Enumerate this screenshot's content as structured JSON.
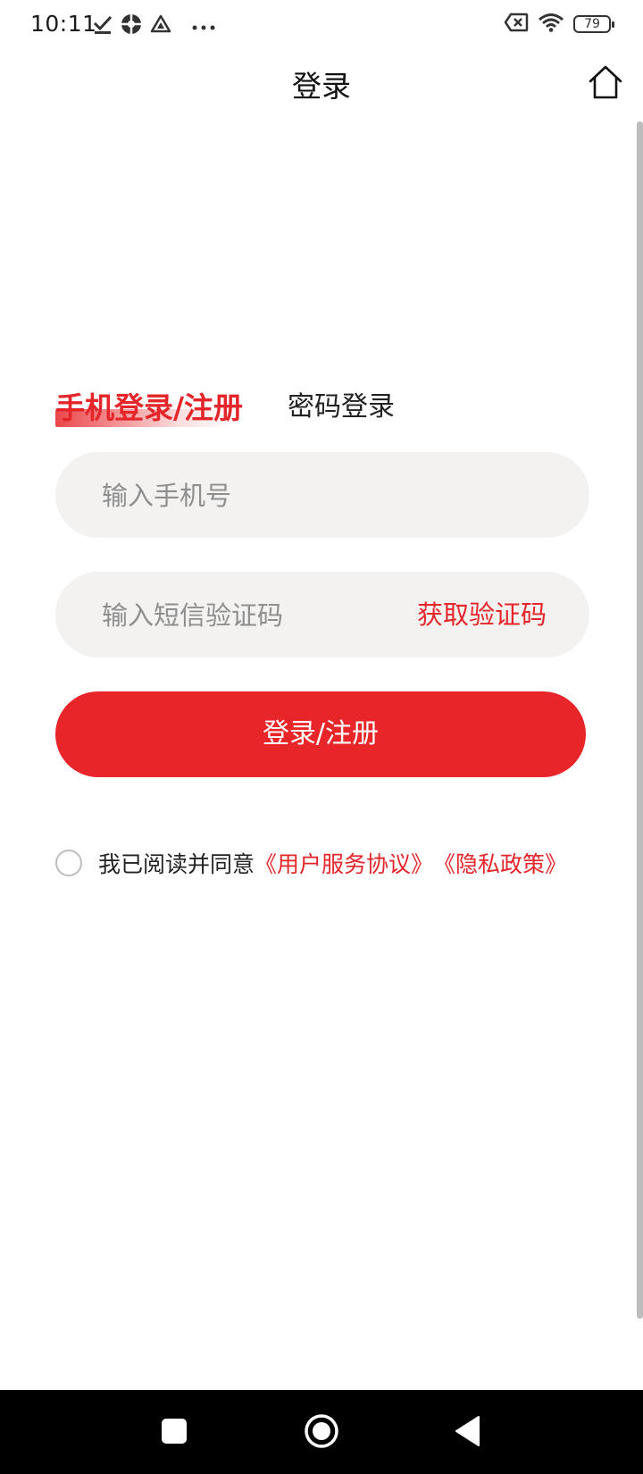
{
  "status_bar": {
    "time": "10:11",
    "battery": "79",
    "icons": [
      "download-done-icon",
      "app-notification-icon",
      "drive-icon",
      "more-dots-icon",
      "sim-off-icon",
      "wifi-icon",
      "battery-icon"
    ]
  },
  "header": {
    "title": "登录",
    "home_icon": "home-icon"
  },
  "tabs": {
    "phone_login": "手机登录/注册",
    "password_login": "密码登录",
    "active": "phone_login"
  },
  "form": {
    "phone_placeholder": "输入手机号",
    "phone_value": "",
    "code_placeholder": "输入短信验证码",
    "code_value": "",
    "get_code_label": "获取验证码",
    "submit_label": "登录/注册"
  },
  "agreement": {
    "checked": false,
    "prefix": "我已阅读并同意",
    "terms_link": "《用户服务协议》",
    "privacy_link": "《隐私政策》"
  },
  "colors": {
    "accent": "#e8262a",
    "input_background": "#f3f2f1",
    "nav_bar": "#000000"
  },
  "nav_bar": {
    "icons": [
      "recents-square-icon",
      "home-circle-icon",
      "back-triangle-icon"
    ]
  }
}
